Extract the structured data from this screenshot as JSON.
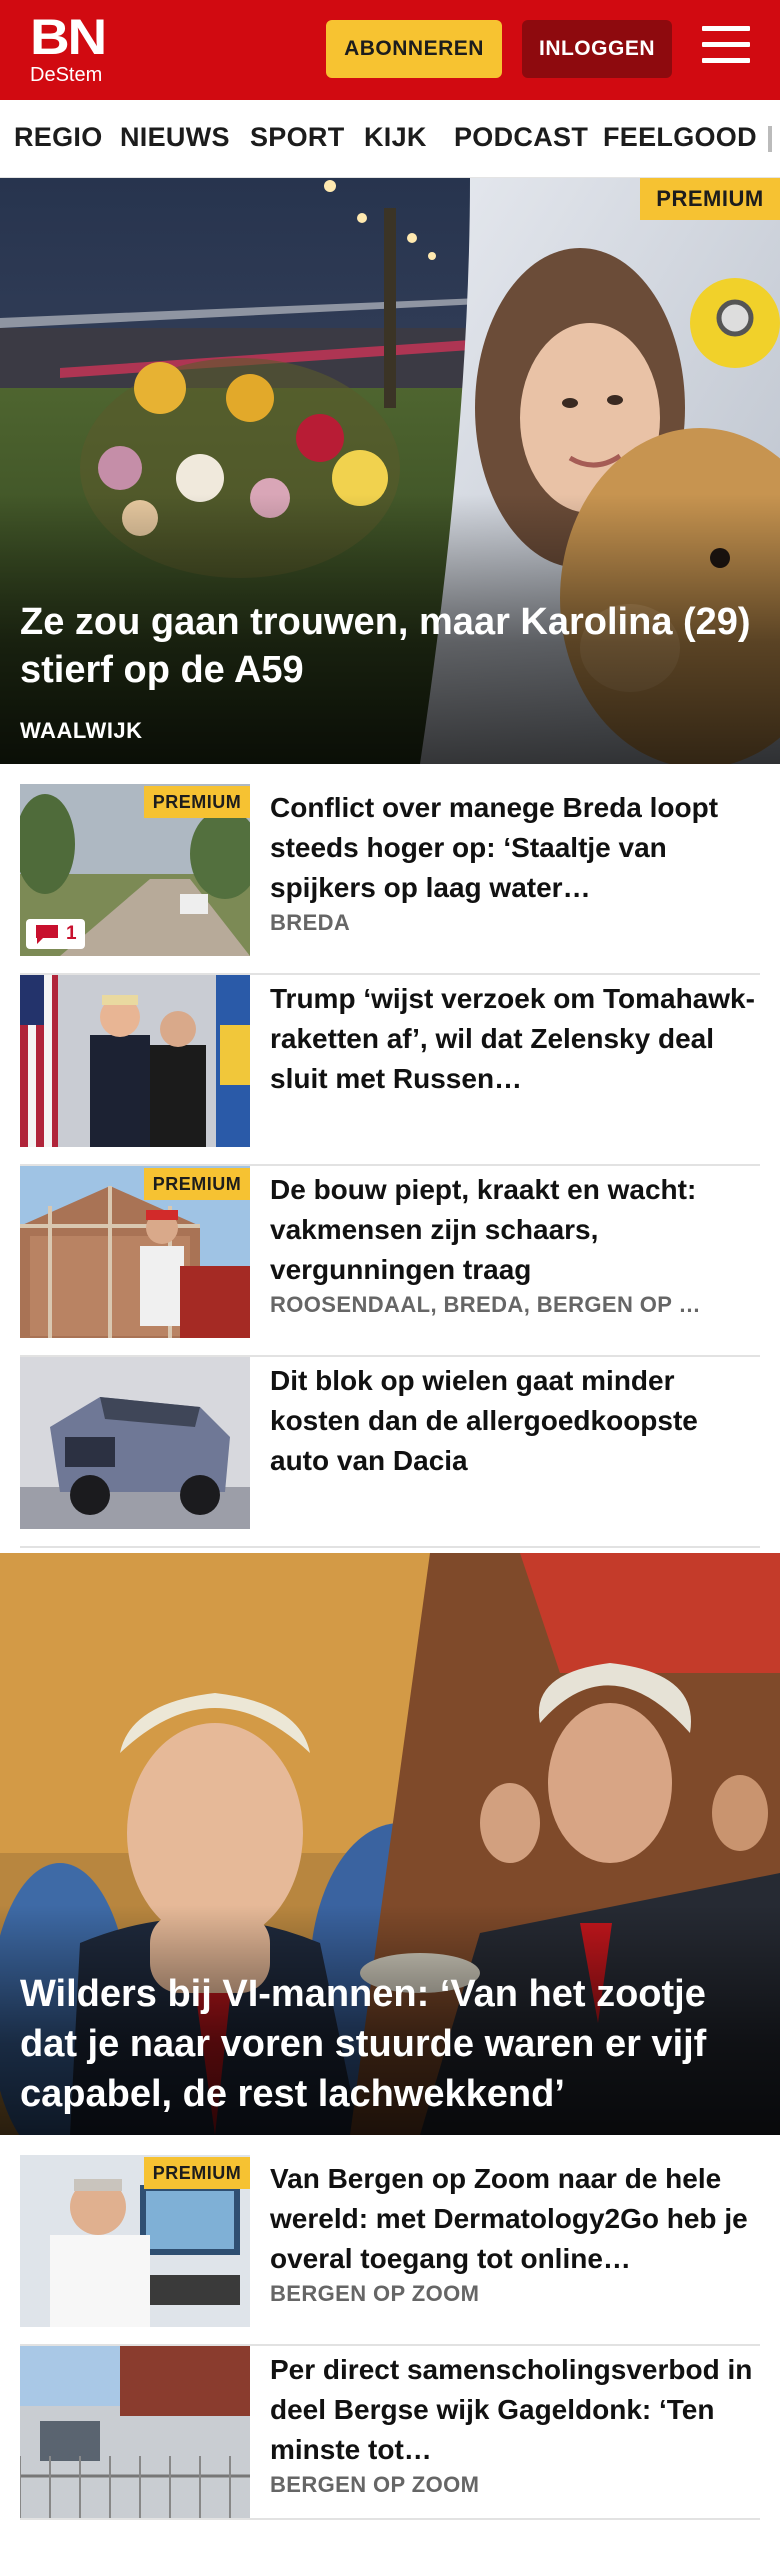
{
  "header": {
    "logo_top": "BN",
    "logo_bottom": "DeStem",
    "subscribe_label": "ABONNEREN",
    "login_label": "INLOGGEN"
  },
  "nav": {
    "items": [
      "REGIO",
      "NIEUWS",
      "SPORT",
      "KIJK",
      "PODCAST",
      "FEELGOOD"
    ]
  },
  "hero": {
    "badge": "PREMIUM",
    "title": "Ze zou gaan trouwen, maar Karolina (29) stierf op de A59",
    "kicker": "WAALWIJK"
  },
  "articles": [
    {
      "badge": "PREMIUM",
      "title": "Conflict over manege Breda loopt steeds hoger op: ‘Staaltje van spijkers op laag water…",
      "location": "BREDA",
      "comments": "1"
    },
    {
      "title": "Trump ‘wijst verzoek om Tomahawk-raketten af’, wil dat Zelensky deal sluit met Russen…"
    },
    {
      "badge": "PREMIUM",
      "title": "De bouw piept, kraakt en wacht: vakmensen zijn schaars, vergunningen traag",
      "location": "ROOSENDAAL, BREDA, BERGEN OP …"
    },
    {
      "title": "Dit blok op wielen gaat minder kosten dan de allergoedkoopste auto van Dacia"
    }
  ],
  "feature": {
    "title": "Wilders bij VI-mannen: ‘Van het zootje dat je naar voren stuurde waren er vijf capabel, de rest lachwekkend’"
  },
  "articles2": [
    {
      "badge": "PREMIUM",
      "title": "Van Bergen op Zoom naar de hele wereld: met Dermatology2Go heb je overal toegang tot online…",
      "location": "BERGEN OP ZOOM"
    },
    {
      "title": "Per direct samenscholingsver­bod in deel Bergse wijk Gageldonk: ‘Ten minste tot…",
      "location": "BERGEN OP ZOOM"
    }
  ],
  "colors": {
    "brand_red": "#d10a11",
    "subscribe_yellow": "#f7c331",
    "login_dark_red": "#8e0a0e",
    "premium_yellow": "#f6c232"
  }
}
